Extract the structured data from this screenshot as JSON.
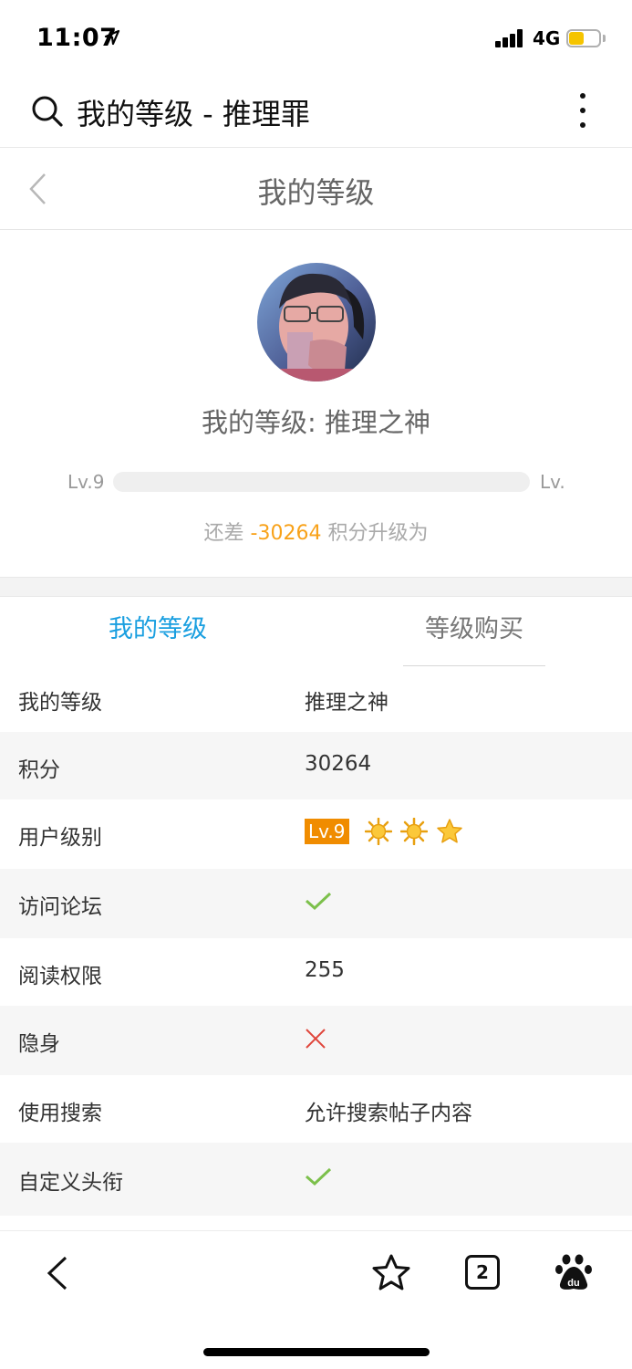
{
  "status_bar": {
    "time": "11:07",
    "network": "4G"
  },
  "browser": {
    "title": "我的等级 - 推理罪"
  },
  "header": {
    "title": "我的等级"
  },
  "profile": {
    "level_heading": "我的等级: 推理之神",
    "lv_left": "Lv.9",
    "lv_right": "Lv.",
    "progress_fraction": 0,
    "diff_prefix": "还差",
    "diff_value": "-30264",
    "diff_suffix": "积分升级为"
  },
  "tabs": {
    "mine": "我的等级",
    "buy": "等级购买"
  },
  "rows": {
    "level": {
      "label": "我的等级",
      "value": "推理之神"
    },
    "points": {
      "label": "积分",
      "value": "30264"
    },
    "user_level": {
      "label": "用户级别",
      "badge": "Lv.9",
      "icons": [
        "sun-icon",
        "sun-icon",
        "star-icon"
      ]
    },
    "forum_access": {
      "label": "访问论坛",
      "icon": "check-icon"
    },
    "read_permission": {
      "label": "阅读权限",
      "value": "255"
    },
    "invisible": {
      "label": "隐身",
      "icon": "cross-icon"
    },
    "search": {
      "label": "使用搜索",
      "value": "允许搜索帖子内容"
    },
    "custom_title": {
      "label": "自定义头衔",
      "icon": "check-icon"
    }
  },
  "bottom_bar": {
    "tab_count": "2"
  },
  "colors": {
    "accent_blue": "#1a9fe0",
    "accent_orange": "#f8a21a",
    "check_green": "#7cc04b",
    "cross_red": "#e0463c"
  }
}
